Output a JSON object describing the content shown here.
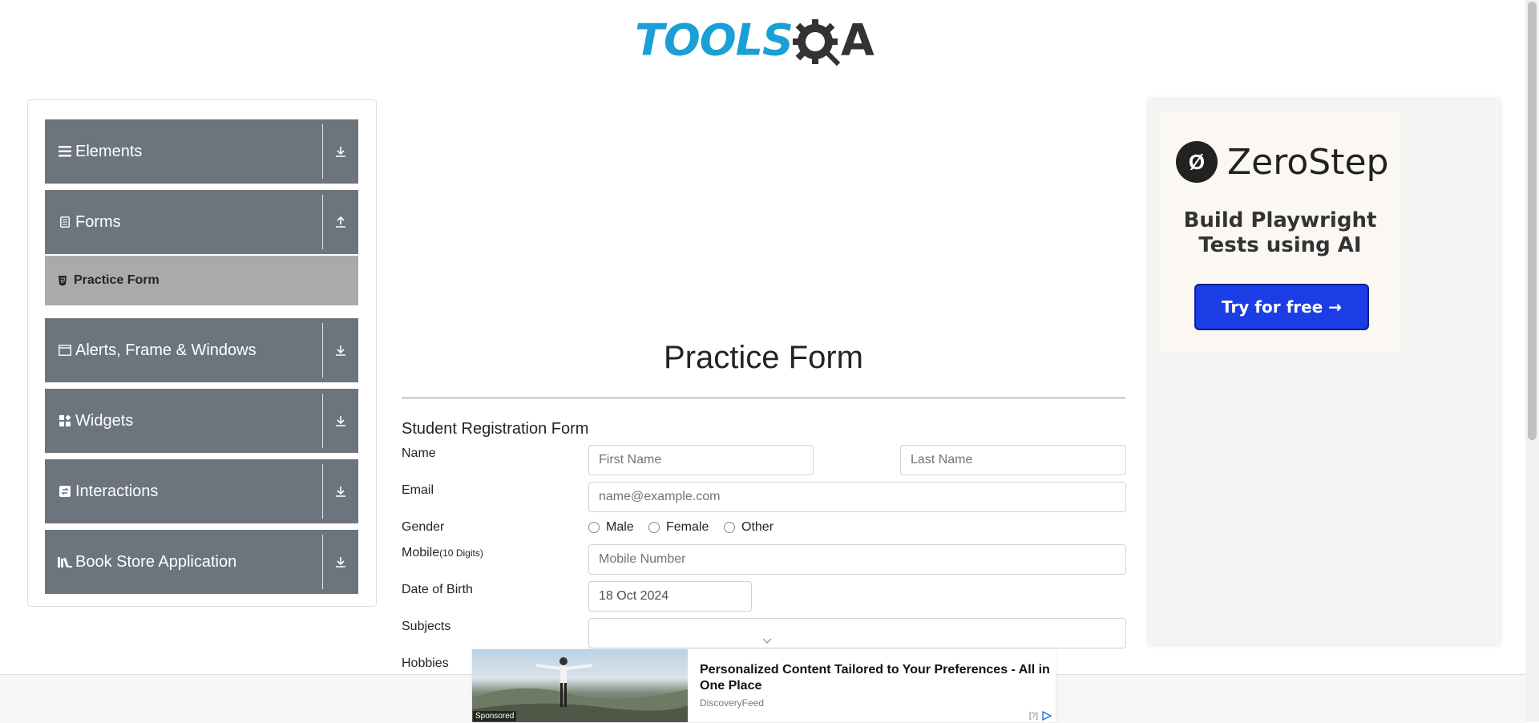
{
  "brand": {
    "logo_main": "TOOLS",
    "logo_suffix": "A"
  },
  "sidebar": {
    "groups": [
      {
        "label": "Elements",
        "icon": "menu-icon",
        "arrow": "download-arrow-icon"
      },
      {
        "label": "Forms",
        "icon": "document-icon",
        "arrow": "upload-arrow-icon"
      },
      {
        "label": "Alerts, Frame & Windows",
        "icon": "window-icon",
        "arrow": "download-arrow-icon"
      },
      {
        "label": "Widgets",
        "icon": "widgets-icon",
        "arrow": "download-arrow-icon"
      },
      {
        "label": "Interactions",
        "icon": "interactions-icon",
        "arrow": "download-arrow-icon"
      },
      {
        "label": "Book Store Application",
        "icon": "books-icon",
        "arrow": "download-arrow-icon"
      }
    ],
    "active_sub": {
      "label": "Practice Form"
    }
  },
  "main": {
    "title": "Practice Form",
    "form_title": "Student Registration Form",
    "labels": {
      "name": "Name",
      "email": "Email",
      "gender": "Gender",
      "mobile": "Mobile",
      "mobile_hint": "(10 Digits)",
      "dob": "Date of Birth",
      "subjects": "Subjects",
      "hobbies": "Hobbies"
    },
    "placeholders": {
      "first_name": "First Name",
      "last_name": "Last Name",
      "email": "name@example.com",
      "mobile": "Mobile Number"
    },
    "gender_options": [
      "Male",
      "Female",
      "Other"
    ],
    "dob_value": "18 Oct 2024"
  },
  "side_ad": {
    "brand": "ZeroStep",
    "tagline": "Build Playwright Tests using AI",
    "button": "Try for free →"
  },
  "bottom_ad": {
    "badge": "Sponsored",
    "headline": "Personalized Content Tailored to Your Preferences - All in One Place",
    "source": "DiscoveryFeed",
    "help": "[?]"
  }
}
